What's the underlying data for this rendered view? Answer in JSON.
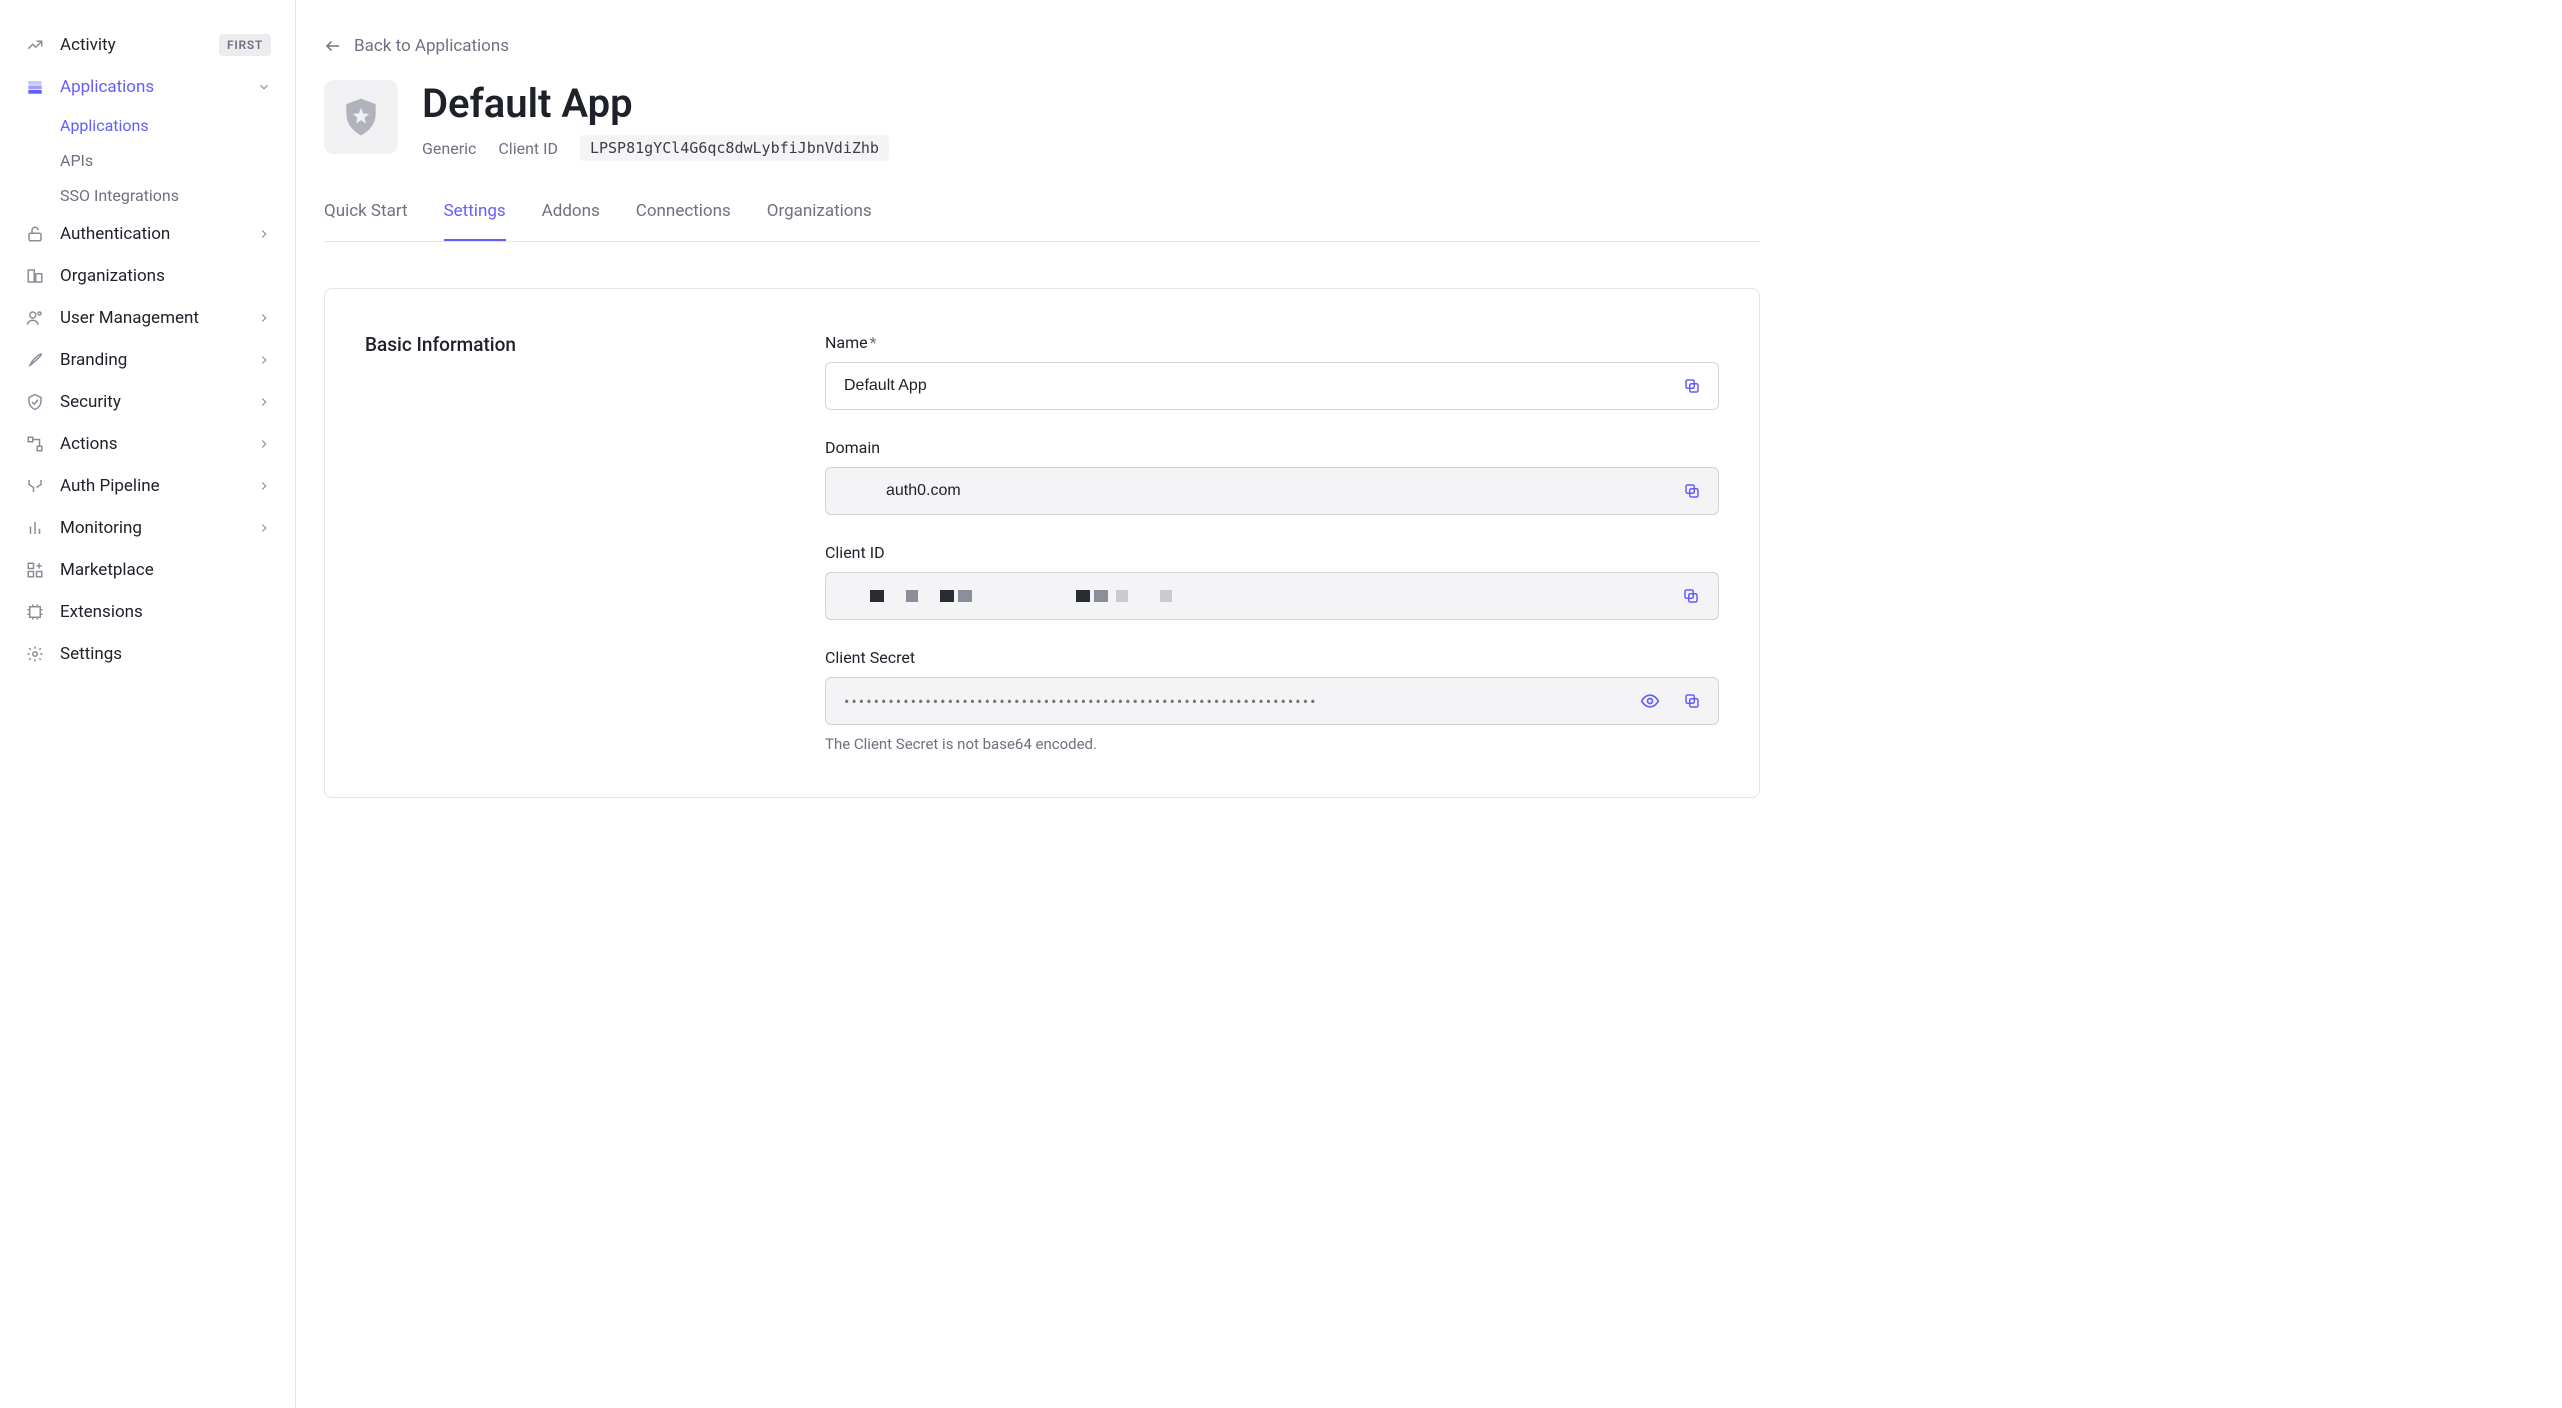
{
  "sidebar": {
    "activity": {
      "label": "Activity",
      "badge": "FIRST"
    },
    "applications": {
      "label": "Applications",
      "items": [
        {
          "label": "Applications",
          "active": true
        },
        {
          "label": "APIs"
        },
        {
          "label": "SSO Integrations"
        }
      ]
    },
    "authentication": {
      "label": "Authentication"
    },
    "organizations": {
      "label": "Organizations"
    },
    "user_management": {
      "label": "User Management"
    },
    "branding": {
      "label": "Branding"
    },
    "security": {
      "label": "Security"
    },
    "actions": {
      "label": "Actions"
    },
    "auth_pipeline": {
      "label": "Auth Pipeline"
    },
    "monitoring": {
      "label": "Monitoring"
    },
    "marketplace": {
      "label": "Marketplace"
    },
    "extensions": {
      "label": "Extensions"
    },
    "settings": {
      "label": "Settings"
    }
  },
  "header": {
    "back_label": "Back to Applications",
    "app_name": "Default App",
    "app_type": "Generic",
    "client_id_label": "Client ID",
    "client_id_value": "LPSP81gYCl4G6qc8dwLybfiJbnVdiZhb"
  },
  "tabs": [
    {
      "label": "Quick Start"
    },
    {
      "label": "Settings",
      "active": true
    },
    {
      "label": "Addons"
    },
    {
      "label": "Connections"
    },
    {
      "label": "Organizations"
    }
  ],
  "basic_info": {
    "title": "Basic Information",
    "name_label": "Name",
    "name_required": "*",
    "name_value": "Default App",
    "domain_label": "Domain",
    "domain_value": "auth0.com",
    "client_id_label": "Client ID",
    "client_secret_label": "Client Secret",
    "client_secret_masked": "••••••••••••••••••••••••••••••••••••••••••••••••••••••••••••••••",
    "client_secret_help": "The Client Secret is not base64 encoded."
  }
}
